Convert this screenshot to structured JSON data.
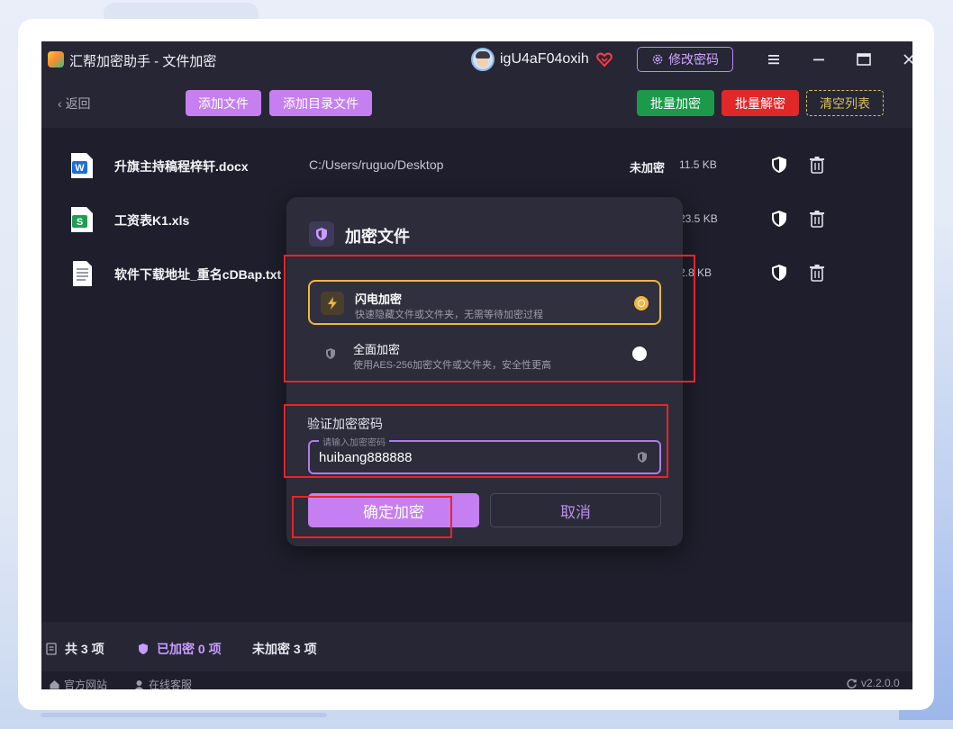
{
  "window": {
    "title": "汇帮加密助手 - 文件加密",
    "username": "igU4aF04oxih",
    "change_password": "修改密码"
  },
  "toolbar": {
    "back": "返回",
    "add_file": "添加文件",
    "add_folder": "添加目录文件",
    "batch_encrypt": "批量加密",
    "batch_decrypt": "批量解密",
    "clear_list": "清空列表"
  },
  "files": [
    {
      "name": "升旗主持稿程梓轩.docx",
      "path": "C:/Users/ruguo/Desktop",
      "status": "未加密",
      "size": "11.5 KB",
      "icon": "word-doc-icon"
    },
    {
      "name": "工资表K1.xls",
      "path": "",
      "status": "",
      "size": "23.5 KB",
      "icon": "spreadsheet-icon"
    },
    {
      "name": "软件下载地址_重名cDBap.txt",
      "path": "",
      "status": "",
      "size": "2.8 KB",
      "icon": "text-file-icon"
    }
  ],
  "statusbar": {
    "total": "共 3 项",
    "encrypted": "已加密 0 项",
    "unencrypted": "未加密 3 项"
  },
  "footer": {
    "website": "官方网站",
    "support": "在线客服",
    "version": "v2.2.0.0"
  },
  "dialog": {
    "title": "加密文件",
    "options": [
      {
        "title": "闪电加密",
        "desc": "快速隐藏文件或文件夹，无需等待加密过程",
        "selected": true
      },
      {
        "title": "全面加密",
        "desc": "使用AES-256加密文件或文件夹，安全性更高",
        "selected": false
      }
    ],
    "password_label": "验证加密密码",
    "password_placeholder": "请输入加密密码",
    "password_value": "huibang888888",
    "confirm": "确定加密",
    "cancel": "取消"
  },
  "colors": {
    "accent_purple": "#c67ff0",
    "green": "#1a9a4a",
    "red": "#e0282a",
    "gold": "#f1b73a",
    "highlight_red": "#e8242a"
  }
}
